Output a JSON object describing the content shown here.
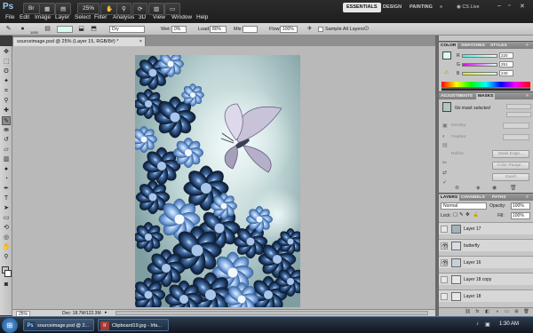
{
  "app": {
    "logo": "Ps",
    "menus": [
      "File",
      "Edit",
      "Image",
      "Layer",
      "Select",
      "Filter",
      "Analysis",
      "3D",
      "View",
      "Window",
      "Help"
    ],
    "zoom": "25%",
    "workspaces": [
      "ESSENTIALS",
      "DESIGN",
      "PAINTING"
    ],
    "more": "»",
    "cslive": "CS Live"
  },
  "options": {
    "mode": "Dry",
    "wet_label": "Wet:",
    "wet_value": "0%",
    "load_label": "Load:",
    "load_value": "80%",
    "mix_label": "Mix:",
    "mix_value": "",
    "flow_label": "Flow:",
    "flow_value": "100%",
    "sample_all": "Sample All Layers",
    "brush_size": "1000"
  },
  "document": {
    "tab_title": "sourceimage.psd @ 25% (Layer 15, RGB/8#) *",
    "zoom": "25%",
    "doc_info": "Doc: 18.7M/122.3M"
  },
  "panels": {
    "color_tabs": [
      "COLOR",
      "SWATCHES",
      "STYLES"
    ],
    "rgb": [
      {
        "label": "R",
        "value": "220"
      },
      {
        "label": "G",
        "value": "251",
        "color": "#d8f0f0"
      },
      {
        "label": "B",
        "value": "240"
      }
    ],
    "adj_tabs": [
      "ADJUSTMENTS",
      "MASKS"
    ],
    "no_mask": "No mask selected",
    "density_label": "Density:",
    "feather_label": "Feather:",
    "refine_label": "Refine:",
    "mask_edge": "Mask Edge...",
    "color_range": "Color Range...",
    "invert": "Invert",
    "layers_tabs": [
      "LAYERS",
      "CHANNELS",
      "PATHS"
    ],
    "blend_mode": "Normal",
    "opacity_label": "Opacity:",
    "opacity_value": "100%",
    "lock_label": "Lock:",
    "fill_label": "Fill:",
    "fill_value": "100%",
    "layers": [
      {
        "name": "Layer 17",
        "visible": false
      },
      {
        "name": "butterfly",
        "visible": true
      },
      {
        "name": "Layer 16",
        "visible": true
      },
      {
        "name": "Layer 18 copy",
        "visible": false
      },
      {
        "name": "Layer 18",
        "visible": false
      }
    ]
  },
  "colors": {
    "foreground": "#dcfbf0",
    "background": "#ffffff",
    "accent": "#1f3a5e"
  },
  "taskbar": {
    "start_icon": "windows-orb-icon",
    "tasks": [
      {
        "label": "sourceimage.psd @ 2...",
        "icon": "Ps"
      },
      {
        "label": "Clipboard19.jpg - Irfa...",
        "icon": "Ir"
      }
    ],
    "clock": "1:30 AM"
  }
}
